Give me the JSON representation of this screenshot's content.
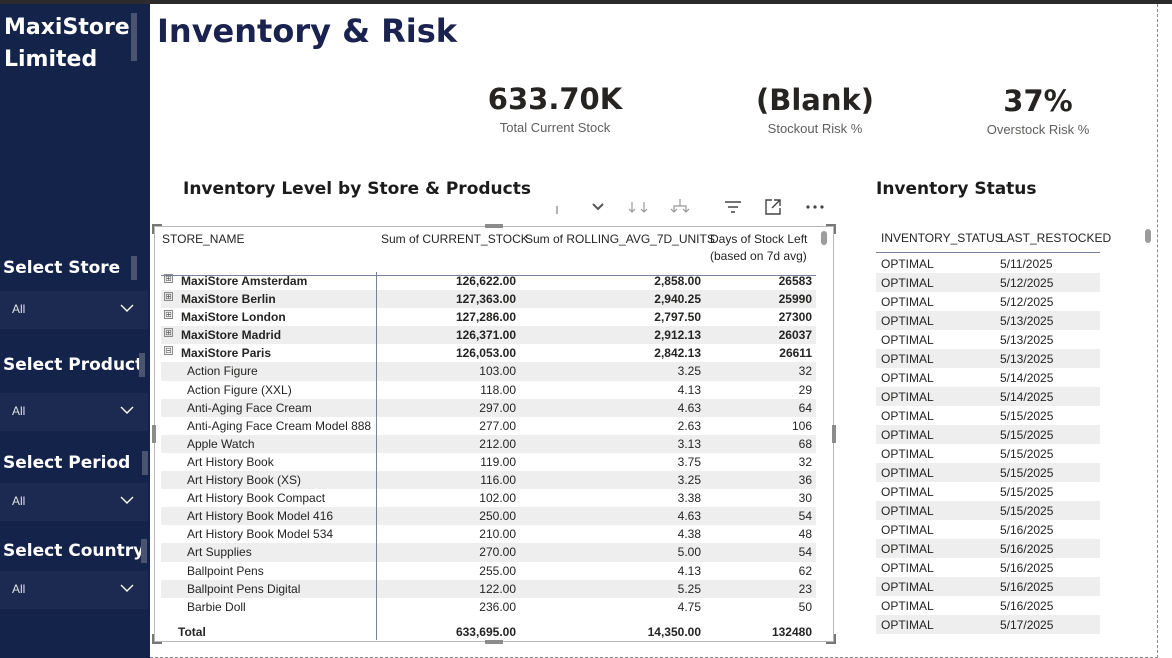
{
  "brand": {
    "title": "MaxiStore Limited"
  },
  "page": {
    "title": "Inventory & Risk"
  },
  "filters": [
    {
      "label": "Select Store",
      "value": "All"
    },
    {
      "label": "Select Product",
      "value": "All"
    },
    {
      "label": "Select Period",
      "value": "All"
    },
    {
      "label": "Select Country",
      "value": "All"
    }
  ],
  "kpis": [
    {
      "value": "633.70K",
      "label": "Total Current Stock"
    },
    {
      "value": "(Blank)",
      "label": "Stockout Risk %"
    },
    {
      "value": "37%",
      "label": "Overstock Risk %"
    }
  ],
  "matrix": {
    "title": "Inventory Level by Store & Products",
    "headers": [
      "STORE_NAME",
      "Sum of CURRENT_STOCK",
      "Sum of ROLLING_AVG_7D_UNITS",
      "Days of Stock Left",
      "(based on 7d avg)"
    ],
    "rows": [
      {
        "type": "store",
        "exp": "⊞",
        "name": "MaxiStore Amsterdam",
        "stock": "126,622.00",
        "avg": "2,858.00",
        "days": "26583"
      },
      {
        "type": "store",
        "exp": "⊞",
        "name": "MaxiStore Berlin",
        "stock": "127,363.00",
        "avg": "2,940.25",
        "days": "25990"
      },
      {
        "type": "store",
        "exp": "⊞",
        "name": "MaxiStore London",
        "stock": "127,286.00",
        "avg": "2,797.50",
        "days": "27300"
      },
      {
        "type": "store",
        "exp": "⊞",
        "name": "MaxiStore Madrid",
        "stock": "126,371.00",
        "avg": "2,912.13",
        "days": "26037"
      },
      {
        "type": "store",
        "exp": "⊟",
        "name": "MaxiStore Paris",
        "stock": "126,053.00",
        "avg": "2,842.13",
        "days": "26611"
      },
      {
        "type": "sub",
        "name": "Action Figure",
        "stock": "103.00",
        "avg": "3.25",
        "days": "32"
      },
      {
        "type": "sub",
        "name": "Action Figure (XXL)",
        "stock": "118.00",
        "avg": "4.13",
        "days": "29"
      },
      {
        "type": "sub",
        "name": "Anti-Aging Face Cream",
        "stock": "297.00",
        "avg": "4.63",
        "days": "64"
      },
      {
        "type": "sub",
        "name": "Anti-Aging Face Cream Model 888",
        "stock": "277.00",
        "avg": "2.63",
        "days": "106"
      },
      {
        "type": "sub",
        "name": "Apple Watch",
        "stock": "212.00",
        "avg": "3.13",
        "days": "68"
      },
      {
        "type": "sub",
        "name": "Art History Book",
        "stock": "119.00",
        "avg": "3.75",
        "days": "32"
      },
      {
        "type": "sub",
        "name": "Art History Book (XS)",
        "stock": "116.00",
        "avg": "3.25",
        "days": "36"
      },
      {
        "type": "sub",
        "name": "Art History Book Compact",
        "stock": "102.00",
        "avg": "3.38",
        "days": "30"
      },
      {
        "type": "sub",
        "name": "Art History Book Model 416",
        "stock": "250.00",
        "avg": "4.63",
        "days": "54"
      },
      {
        "type": "sub",
        "name": "Art History Book Model 534",
        "stock": "210.00",
        "avg": "4.38",
        "days": "48"
      },
      {
        "type": "sub",
        "name": "Art Supplies",
        "stock": "270.00",
        "avg": "5.00",
        "days": "54"
      },
      {
        "type": "sub",
        "name": "Ballpoint Pens",
        "stock": "255.00",
        "avg": "4.13",
        "days": "62"
      },
      {
        "type": "sub",
        "name": "Ballpoint Pens Digital",
        "stock": "122.00",
        "avg": "5.25",
        "days": "23"
      },
      {
        "type": "sub",
        "name": "Barbie Doll",
        "stock": "236.00",
        "avg": "4.75",
        "days": "50"
      }
    ],
    "total": {
      "label": "Total",
      "stock": "633,695.00",
      "avg": "14,350.00",
      "days": "132480"
    }
  },
  "status": {
    "title": "Inventory Status",
    "headers": [
      "INVENTORY_STATUS",
      "LAST_RESTOCKED"
    ],
    "rows": [
      [
        "OPTIMAL",
        "5/11/2025"
      ],
      [
        "OPTIMAL",
        "5/12/2025"
      ],
      [
        "OPTIMAL",
        "5/12/2025"
      ],
      [
        "OPTIMAL",
        "5/13/2025"
      ],
      [
        "OPTIMAL",
        "5/13/2025"
      ],
      [
        "OPTIMAL",
        "5/13/2025"
      ],
      [
        "OPTIMAL",
        "5/14/2025"
      ],
      [
        "OPTIMAL",
        "5/14/2025"
      ],
      [
        "OPTIMAL",
        "5/15/2025"
      ],
      [
        "OPTIMAL",
        "5/15/2025"
      ],
      [
        "OPTIMAL",
        "5/15/2025"
      ],
      [
        "OPTIMAL",
        "5/15/2025"
      ],
      [
        "OPTIMAL",
        "5/15/2025"
      ],
      [
        "OPTIMAL",
        "5/15/2025"
      ],
      [
        "OPTIMAL",
        "5/16/2025"
      ],
      [
        "OPTIMAL",
        "5/16/2025"
      ],
      [
        "OPTIMAL",
        "5/16/2025"
      ],
      [
        "OPTIMAL",
        "5/16/2025"
      ],
      [
        "OPTIMAL",
        "5/16/2025"
      ],
      [
        "OPTIMAL",
        "5/17/2025"
      ]
    ]
  },
  "toolbar_icons": [
    "drill-up-icon",
    "drill-down-icon",
    "expand-all-icon",
    "hierarchy-icon",
    "filter-icon",
    "focus-mode-icon",
    "more-options-icon"
  ],
  "colors": {
    "sidebar": "#13234a",
    "dropdown": "#1c2a52",
    "title": "#1a2350",
    "row_alt": "#eeeeee"
  }
}
